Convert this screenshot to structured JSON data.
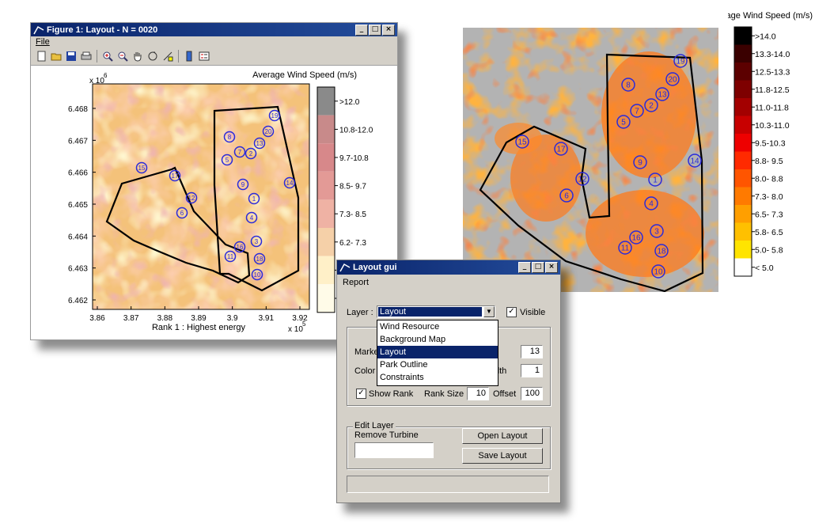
{
  "figure_window": {
    "title": "Figure 1: Layout - N = 0020",
    "menu": [
      "File"
    ],
    "toolbar_icons": [
      "new-file-icon",
      "open-folder-icon",
      "save-icon",
      "print-icon",
      "zoom-in-icon",
      "zoom-out-icon",
      "pan-hand-icon",
      "rotate-icon",
      "data-cursor-icon",
      "colorbar-icon",
      "legend-icon"
    ],
    "plot": {
      "colorbar_title": "Average Wind Speed (m/s)",
      "colorbar_labels": [
        ">12.0",
        "10.8-12.0",
        "9.7-10.8",
        "8.5- 9.7",
        "7.3- 8.5",
        "6.2- 7.3",
        "",
        ""
      ],
      "x_ticks": [
        "3.86",
        "3.87",
        "3.88",
        "3.89",
        "3.9",
        "3.91",
        "3.92"
      ],
      "y_ticks": [
        "6.468",
        "6.467",
        "6.466",
        "6.465",
        "6.464",
        "6.463",
        "6.462"
      ],
      "x_multiplier": "x 10",
      "x_multiplier_exp": "5",
      "y_multiplier": "x 10",
      "y_multiplier_exp": "6",
      "xlabel": "Rank 1 : Highest energy"
    }
  },
  "right_map": {
    "colorbar_title": "Average Wind Speed (m/s)",
    "colorbar_labels": [
      ">14.0",
      "13.3-14.0",
      "12.5-13.3",
      "11.8-12.5",
      "11.0-11.8",
      "10.3-11.0",
      "9.5-10.3",
      "8.8- 9.5",
      "8.0- 8.8",
      "7.3- 8.0",
      "6.5- 7.3",
      "5.8- 6.5",
      "5.0- 5.8",
      "< 5.0"
    ]
  },
  "turbines": [
    "19",
    "20",
    "8",
    "13",
    "7",
    "2",
    "5",
    "9",
    "14",
    "15",
    "17",
    "12",
    "6",
    "1",
    "4",
    "3",
    "16",
    "11",
    "18",
    "10"
  ],
  "layout_gui": {
    "title": "Layout gui",
    "menu": "Report",
    "layer_label": "Layer :",
    "layer_value": "Layout",
    "visible_label": "Visible",
    "visible_checked": true,
    "layer_options": [
      "Wind Resource",
      "Background Map",
      "Layout",
      "Park Outline",
      "Constraints"
    ],
    "selected_option": "Layout",
    "marker_label": "Marke",
    "marker_value": "13",
    "color_label": "Color",
    "width_label": "dth",
    "width_value": "1",
    "show_rank_label": "Show Rank",
    "show_rank_checked": true,
    "rank_size_label": "Rank Size",
    "rank_size_value": "10",
    "offset_label": "Offset",
    "offset_value": "100",
    "edit_layer_label": "Edit Layer",
    "remove_turbine_label": "Remove Turbine",
    "remove_turbine_value": "",
    "open_layout_label": "Open Layout",
    "save_layout_label": "Save Layout"
  },
  "colors": {
    "titlebar": "#0a246a",
    "dialog_bg": "#d4d0c8",
    "turbine_marker": "#2a2adb"
  }
}
